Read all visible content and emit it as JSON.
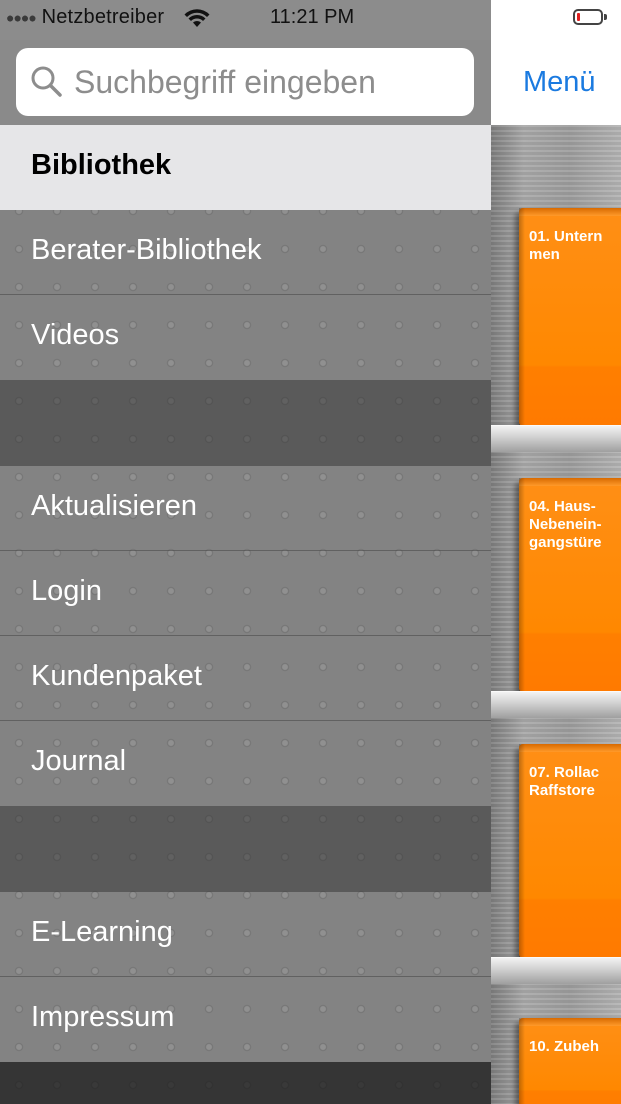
{
  "status_bar": {
    "carrier": "Netzbetreiber",
    "time": "11:21 PM",
    "battery_level": 0.1,
    "battery_color": "#e02020"
  },
  "search": {
    "placeholder": "Suchbegriff eingeben",
    "icon": "search-icon"
  },
  "sidebar": {
    "selected": "Bibliothek",
    "groups": [
      {
        "items": [
          {
            "label": "Bibliothek"
          },
          {
            "label": "Berater-Bibliothek"
          },
          {
            "label": "Videos"
          }
        ]
      },
      {
        "items": [
          {
            "label": "Aktualisieren"
          },
          {
            "label": "Login"
          },
          {
            "label": "Kundenpaket"
          },
          {
            "label": "Journal"
          }
        ]
      },
      {
        "items": [
          {
            "label": "E-Learning"
          },
          {
            "label": "Impressum"
          }
        ]
      }
    ]
  },
  "navbar": {
    "menu_label": "Menü",
    "accent_color": "#1a7ae0"
  },
  "shelf": {
    "book_color": "#ff8800",
    "books": [
      {
        "title": "01. Untern\nmen"
      },
      {
        "title": "04. Haus-\nNebenein-\ngangstüre"
      },
      {
        "title": "07. Rollac\nRaffstore"
      },
      {
        "title": "10. Zubeh"
      }
    ]
  }
}
